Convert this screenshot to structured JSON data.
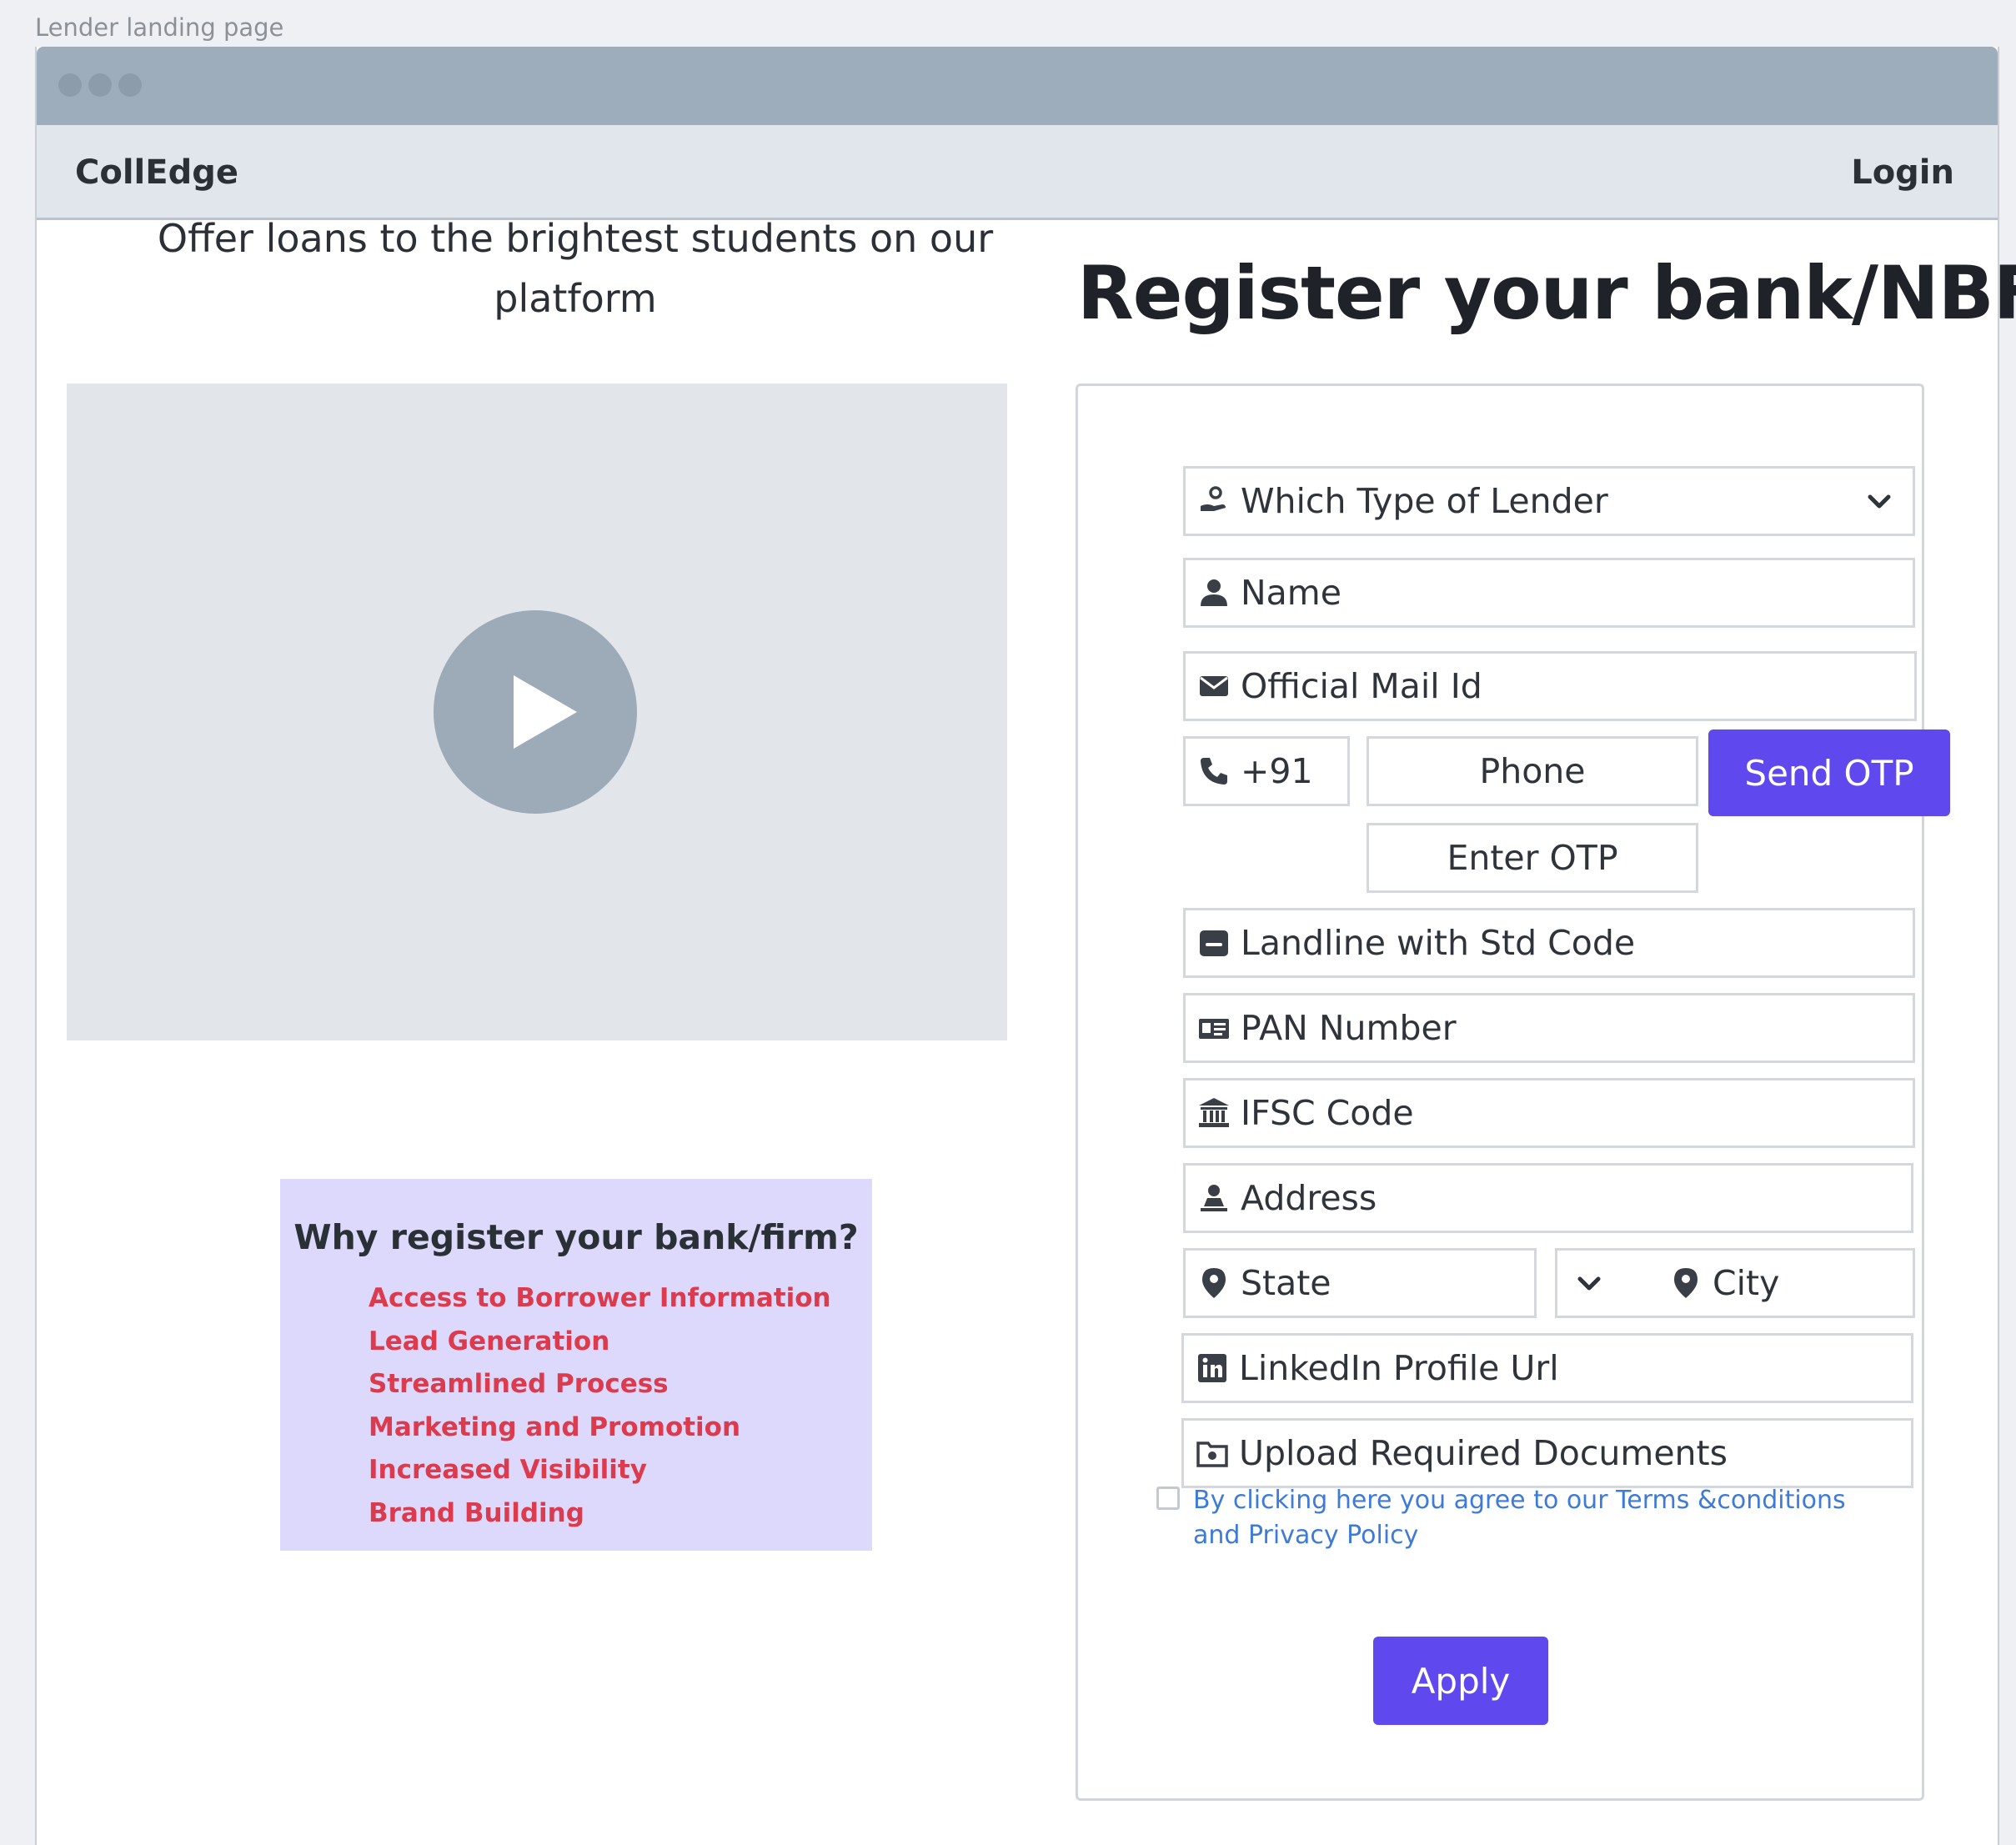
{
  "page_caption": "Lender landing page",
  "navbar": {
    "brand": "CollEdge",
    "login_label": "Login"
  },
  "left": {
    "tagline": "Offer loans to the brightest students on our platform",
    "why_box": {
      "title": "Why register your bank/firm?",
      "items": [
        "Access to Borrower Information",
        "Lead Generation",
        "Streamlined Process",
        "Marketing and Promotion",
        "Increased Visibility",
        "Brand Building"
      ]
    }
  },
  "form": {
    "title": "Register your bank/NBFC",
    "lender_type": "Which Type of Lender",
    "name": "Name",
    "mail": "Official Mail Id",
    "country_code": "+91",
    "phone": "Phone",
    "send_otp": "Send OTP",
    "otp": "Enter OTP",
    "landline": "Landline with Std Code",
    "pan": "PAN Number",
    "ifsc": "IFSC Code",
    "address": "Address",
    "state": "State",
    "city": "City",
    "linkedin": "LinkedIn Profile Url",
    "upload": "Upload Required Documents",
    "terms": "By clicking here you agree to our Terms &conditions and Privacy Policy",
    "apply": "Apply"
  },
  "colors": {
    "accent": "#5f49ee",
    "why_bg": "#ddd9fc",
    "why_items": "#dc3b4d",
    "link": "#3e7ad8"
  },
  "icons": [
    "hand-coin-icon",
    "user-icon",
    "envelope-icon",
    "phone-icon",
    "landline-icon",
    "id-card-icon",
    "bank-icon",
    "address-icon",
    "map-pin-icon",
    "linkedin-icon",
    "upload-folder-icon",
    "chevron-down-icon",
    "play-icon"
  ]
}
